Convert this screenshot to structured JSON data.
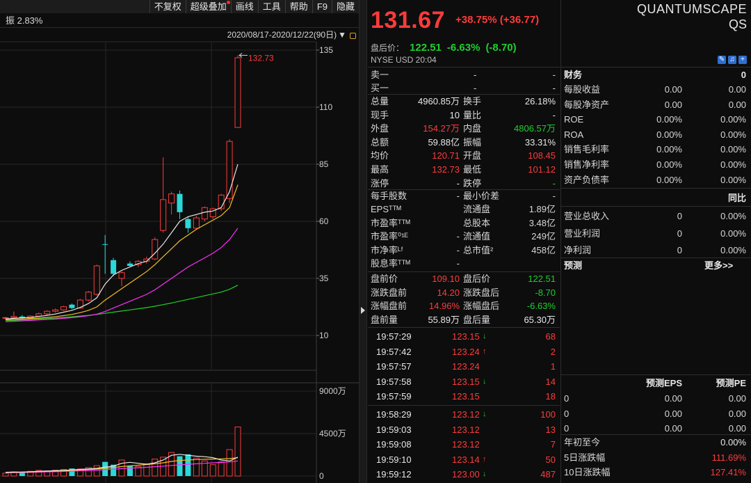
{
  "toolbar": {
    "items": [
      {
        "label": "不复权",
        "dot": false
      },
      {
        "label": "超级叠加",
        "dot": true
      },
      {
        "label": "画线",
        "dot": false
      },
      {
        "label": "工具",
        "dot": false
      },
      {
        "label": "帮助",
        "dot": false
      },
      {
        "label": "F9",
        "dot": false
      },
      {
        "label": "隐藏",
        "dot": false
      }
    ]
  },
  "chart": {
    "amplitude": "振 2.83%",
    "date_range": "2020/08/17-2020/12/22(90日)",
    "high_label": "132.73",
    "price_ticks": [
      "135",
      "110",
      "85",
      "60",
      "35",
      "10"
    ],
    "volume_ticks": [
      "9000万",
      "4500万",
      "0"
    ],
    "colors": {
      "up": "#ff3b3b",
      "down": "#2ad8d8",
      "ma5": "#e8e8e8",
      "ma10": "#f0c020",
      "ma20": "#ff30ff",
      "ma60": "#20d020"
    },
    "candles": [
      {
        "o": 17.5,
        "h": 18.2,
        "l": 17.0,
        "c": 17.8
      },
      {
        "o": 17.8,
        "h": 20.5,
        "l": 17.5,
        "c": 18.3
      },
      {
        "o": 18.3,
        "h": 19.0,
        "l": 17.2,
        "c": 17.6
      },
      {
        "o": 17.6,
        "h": 18.8,
        "l": 17.2,
        "c": 18.5
      },
      {
        "o": 18.5,
        "h": 20.0,
        "l": 18.0,
        "c": 19.5
      },
      {
        "o": 19.5,
        "h": 21.0,
        "l": 19.0,
        "c": 20.6
      },
      {
        "o": 20.6,
        "h": 21.8,
        "l": 20.0,
        "c": 21.2
      },
      {
        "o": 21.2,
        "h": 23.0,
        "l": 20.8,
        "c": 22.6
      },
      {
        "o": 23.5,
        "h": 24.0,
        "l": 21.5,
        "c": 22.0
      },
      {
        "o": 22.0,
        "h": 26.0,
        "l": 21.8,
        "c": 25.5
      },
      {
        "o": 25.5,
        "h": 29.5,
        "l": 25.0,
        "c": 29.0
      },
      {
        "o": 28.0,
        "h": 41.0,
        "l": 27.5,
        "c": 40.5
      },
      {
        "o": 50.0,
        "h": 54.0,
        "l": 37.0,
        "c": 49.8
      },
      {
        "o": 43.0,
        "h": 44.0,
        "l": 36.0,
        "c": 37.0
      },
      {
        "o": 35.0,
        "h": 38.0,
        "l": 31.5,
        "c": 37.5
      },
      {
        "o": 41.5,
        "h": 42.5,
        "l": 40.0,
        "c": 40.5
      },
      {
        "o": 41.0,
        "h": 43.0,
        "l": 40.0,
        "c": 42.5
      },
      {
        "o": 42.5,
        "h": 44.5,
        "l": 41.5,
        "c": 43.5
      },
      {
        "o": 43.5,
        "h": 53.0,
        "l": 43.0,
        "c": 52.0
      },
      {
        "o": 56.0,
        "h": 88.0,
        "l": 55.0,
        "c": 69.5
      },
      {
        "o": 68.0,
        "h": 73.0,
        "l": 63.0,
        "c": 72.0
      },
      {
        "o": 72.0,
        "h": 73.5,
        "l": 61.0,
        "c": 64.0
      },
      {
        "o": 61.0,
        "h": 62.0,
        "l": 55.0,
        "c": 57.0
      },
      {
        "o": 57.0,
        "h": 62.5,
        "l": 56.5,
        "c": 61.5
      },
      {
        "o": 61.0,
        "h": 66.5,
        "l": 60.0,
        "c": 66.0
      },
      {
        "o": 62.0,
        "h": 66.0,
        "l": 61.0,
        "c": 65.5
      },
      {
        "o": 65.5,
        "h": 72.0,
        "l": 64.5,
        "c": 71.5
      },
      {
        "o": 70.0,
        "h": 96.0,
        "l": 68.0,
        "c": 95.0
      },
      {
        "o": 101.12,
        "h": 132.73,
        "l": 101.0,
        "c": 131.67
      }
    ],
    "ma5": [
      17.2,
      17.5,
      17.7,
      17.9,
      18.3,
      18.8,
      19.4,
      20.2,
      21.0,
      22.3,
      24.0,
      26.5,
      32.5,
      36.5,
      38.5,
      40.0,
      41.5,
      42.5,
      46.0,
      50.0,
      55.0,
      60.0,
      62.0,
      63.0,
      64.0,
      64.5,
      66.0,
      73.0,
      85.0
    ],
    "ma10": [
      16.8,
      17.0,
      17.2,
      17.4,
      17.6,
      17.9,
      18.2,
      18.7,
      19.2,
      20.0,
      21.0,
      22.5,
      25.5,
      28.0,
      30.5,
      33.0,
      35.5,
      38.0,
      41.0,
      44.5,
      48.0,
      51.5,
      54.0,
      56.5,
      58.5,
      60.5,
      62.5,
      66.0,
      76.0
    ],
    "ma20": [
      16.0,
      16.2,
      16.4,
      16.6,
      16.8,
      17.0,
      17.2,
      17.5,
      17.8,
      18.2,
      18.7,
      19.3,
      20.5,
      22.0,
      23.5,
      25.0,
      26.5,
      28.0,
      30.0,
      32.5,
      35.0,
      37.5,
      40.0,
      42.0,
      44.0,
      46.0,
      48.5,
      52.0,
      57.0
    ],
    "ma60": [
      16.5,
      16.6,
      16.8,
      17.0,
      17.2,
      17.4,
      17.6,
      17.9,
      18.2,
      18.5,
      18.8,
      19.2,
      19.7,
      20.2,
      20.7,
      21.2,
      21.7,
      22.2,
      22.8,
      23.5,
      24.2,
      25.0,
      25.8,
      26.6,
      27.4,
      28.2,
      29.0,
      30.2,
      32.0
    ],
    "volumes": [
      300,
      450,
      380,
      500,
      600,
      550,
      620,
      700,
      800,
      750,
      900,
      1100,
      1500,
      1200,
      1700,
      1100,
      1000,
      1300,
      1800,
      2000,
      2500,
      2100,
      2300,
      1900,
      1600,
      1200,
      1500,
      2800,
      5200
    ],
    "vol_ma1": [
      400,
      420,
      430,
      460,
      500,
      540,
      560,
      600,
      650,
      700,
      760,
      820,
      950,
      1050,
      1350,
      1450,
      1350,
      1250,
      1400,
      1700,
      2200,
      2300,
      2200,
      2100,
      2050,
      1950,
      1700,
      1600,
      2000
    ],
    "vol_ma2": [
      380,
      400,
      410,
      430,
      460,
      500,
      520,
      560,
      600,
      640,
      690,
      740,
      820,
      900,
      1000,
      1080,
      1150,
      1220,
      1300,
      1400,
      1550,
      1650,
      1700,
      1750,
      1780,
      1800,
      1820,
      1850,
      1950
    ],
    "vol_ma3": [
      350,
      360,
      370,
      390,
      410,
      440,
      460,
      490,
      520,
      550,
      580,
      620,
      670,
      720,
      780,
      830,
      880,
      930,
      990,
      1050,
      1120,
      1190,
      1250,
      1300,
      1350,
      1400,
      1440,
      1500,
      1600
    ]
  },
  "quote": {
    "price": "131.67",
    "change": "+38.75% (+36.77)",
    "ah_label": "盘后价：",
    "ah_price": "122.51",
    "ah_pct": "-6.63%",
    "ah_chg": "(-8.70)",
    "exchange": "NYSE  USD  20:04",
    "sell1_label": "卖一",
    "buy1_label": "买一",
    "dash": "-",
    "rows": [
      {
        "l1": "总量",
        "v1": "4960.85万",
        "c1": "white",
        "l2": "换手",
        "v2": "26.18%",
        "c2": "white"
      },
      {
        "l1": "现手",
        "v1": "10",
        "c1": "white",
        "l2": "量比",
        "v2": "-",
        "c2": "white"
      },
      {
        "l1": "外盘",
        "v1": "154.27万",
        "c1": "red",
        "l2": "内盘",
        "v2": "4806.57万",
        "c2": "green"
      },
      {
        "l1": "总额",
        "v1": "59.88亿",
        "c1": "white",
        "l2": "振幅",
        "v2": "33.31%",
        "c2": "white"
      },
      {
        "l1": "均价",
        "v1": "120.71",
        "c1": "red",
        "l2": "开盘",
        "v2": "108.45",
        "c2": "red"
      },
      {
        "l1": "最高",
        "v1": "132.73",
        "c1": "red",
        "l2": "最低",
        "v2": "101.12",
        "c2": "red"
      },
      {
        "l1": "涨停",
        "v1": "-",
        "c1": "white",
        "l2": "跌停",
        "v2": "-",
        "c2": "green"
      }
    ],
    "rows2": [
      {
        "l1": "每手股数",
        "v1": "-",
        "l2": "最小价差",
        "v2": "-"
      },
      {
        "l1": "EPSᵀᵀᴹ",
        "v1": "",
        "l2": "流通盘",
        "v2": "1.89亿"
      },
      {
        "l1": "市盈率ᵀᵀᴹ",
        "v1": "",
        "l2": "总股本",
        "v2": "3.48亿"
      },
      {
        "l1": "市盈率⁰¹ᴱ",
        "v1": "-",
        "l2": "流通值",
        "v2": "249亿"
      },
      {
        "l1": "市净率ᴸᶠ",
        "v1": "-",
        "l2": "总市值²",
        "v2": "458亿"
      },
      {
        "l1": "股息率ᵀᵀᴹ",
        "v1": "-",
        "l2": "",
        "v2": ""
      }
    ],
    "rows3": [
      {
        "l1": "盘前价",
        "v1": "109.10",
        "c1": "red",
        "l2": "盘后价",
        "v2": "122.51",
        "c2": "green"
      },
      {
        "l1": "涨跌盘前",
        "v1": "14.20",
        "c1": "red",
        "l2": "涨跌盘后",
        "v2": "-8.70",
        "c2": "green"
      },
      {
        "l1": "涨幅盘前",
        "v1": "14.96%",
        "c1": "red",
        "l2": "涨幅盘后",
        "v2": "-6.63%",
        "c2": "green"
      },
      {
        "l1": "盘前量",
        "v1": "55.89万",
        "c1": "white",
        "l2": "盘后量",
        "v2": "65.30万",
        "c2": "white"
      }
    ],
    "ticks": [
      {
        "time": "19:57:29",
        "price": "123.15",
        "dir": "down",
        "vol": "68"
      },
      {
        "time": "19:57:42",
        "price": "123.24",
        "dir": "up",
        "vol": "2"
      },
      {
        "time": "19:57:57",
        "price": "123.24",
        "dir": "",
        "vol": "1"
      },
      {
        "time": "19:57:58",
        "price": "123.15",
        "dir": "down",
        "vol": "14"
      },
      {
        "time": "19:57:59",
        "price": "123.15",
        "dir": "",
        "vol": "18"
      },
      {
        "time": "19:58:29",
        "price": "123.12",
        "dir": "down",
        "vol": "100"
      },
      {
        "time": "19:59:03",
        "price": "123.12",
        "dir": "",
        "vol": "13"
      },
      {
        "time": "19:59:08",
        "price": "123.12",
        "dir": "",
        "vol": "7"
      },
      {
        "time": "19:59:10",
        "price": "123.14",
        "dir": "up",
        "vol": "50"
      },
      {
        "time": "19:59:12",
        "price": "123.00",
        "dir": "down",
        "vol": "487"
      }
    ]
  },
  "fin": {
    "company": "QUANTUMSCAPE",
    "ticker": "QS",
    "finance_label": "财务",
    "finance_value": "0",
    "rows": [
      {
        "label": "每股收益",
        "v1": "0.00",
        "v2": "0.00"
      },
      {
        "label": "每股净资产",
        "v1": "0.00",
        "v2": "0.00"
      },
      {
        "label": "ROE",
        "v1": "0.00%",
        "v2": "0.00%"
      },
      {
        "label": "ROA",
        "v1": "0.00%",
        "v2": "0.00%"
      },
      {
        "label": "销售毛利率",
        "v1": "0.00%",
        "v2": "0.00%"
      },
      {
        "label": "销售净利率",
        "v1": "0.00%",
        "v2": "0.00%"
      },
      {
        "label": "资产负债率",
        "v1": "0.00%",
        "v2": "0.00%"
      }
    ],
    "yoy_label": "同比",
    "rows2": [
      {
        "label": "营业总收入",
        "v1": "0",
        "v2": "0.00%"
      },
      {
        "label": "营业利润",
        "v1": "0",
        "v2": "0.00%"
      },
      {
        "label": "净利润",
        "v1": "0",
        "v2": "0.00%"
      }
    ],
    "forecast_label": "预测",
    "more_label": "更多>>",
    "eps_header": "预测EPS",
    "pe_header": "预测PE",
    "forecast_rows": [
      {
        "label": "0",
        "v1": "0.00",
        "v2": "0.00"
      },
      {
        "label": "0",
        "v1": "0.00",
        "v2": "0.00"
      },
      {
        "label": "0",
        "v1": "0.00",
        "v2": "0.00"
      }
    ],
    "bottom_rows": [
      {
        "label": "年初至今",
        "value": "0.00%",
        "color": "white"
      },
      {
        "label": "5日涨跌幅",
        "value": "111.69%",
        "color": "red"
      },
      {
        "label": "10日涨跌幅",
        "value": "127.41%",
        "color": "red"
      }
    ]
  }
}
